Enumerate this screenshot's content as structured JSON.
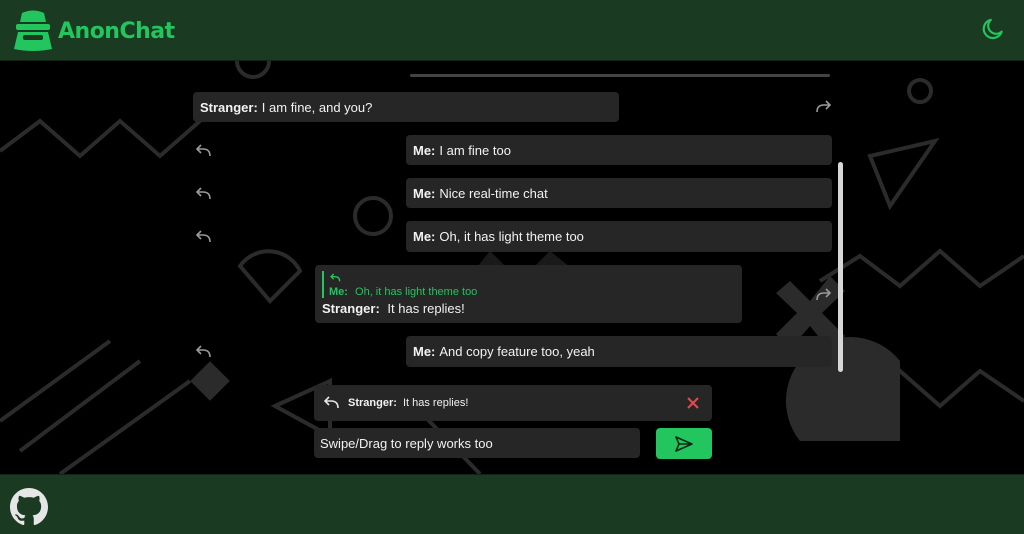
{
  "app": {
    "title": "AnonChat"
  },
  "colors": {
    "accent": "#22c55e",
    "header_bg": "#1b3a22",
    "bubble_bg": "#262626",
    "danger": "#e5484d"
  },
  "messages": [
    {
      "sender": "Stranger:",
      "text": "I am fine, and you?"
    },
    {
      "sender": "Me:",
      "text": "I am fine too"
    },
    {
      "sender": "Me:",
      "text": "Nice real-time chat"
    },
    {
      "sender": "Me:",
      "text": "Oh, it has light theme too"
    },
    {
      "quote_sender": "Me:",
      "quote_text": "Oh, it has light theme too",
      "sender": "Stranger:",
      "text": "It has replies!"
    },
    {
      "sender": "Me:",
      "text": "And copy feature too, yeah"
    }
  ],
  "replying_to": {
    "sender": "Stranger:",
    "text": "It has replies!"
  },
  "composer": {
    "value": "Swipe/Drag to reply works too"
  },
  "icons": {
    "theme": "moon-icon",
    "footer": "github-icon",
    "reply": "reply-arrow-icon",
    "close": "close-icon",
    "send": "send-icon"
  }
}
